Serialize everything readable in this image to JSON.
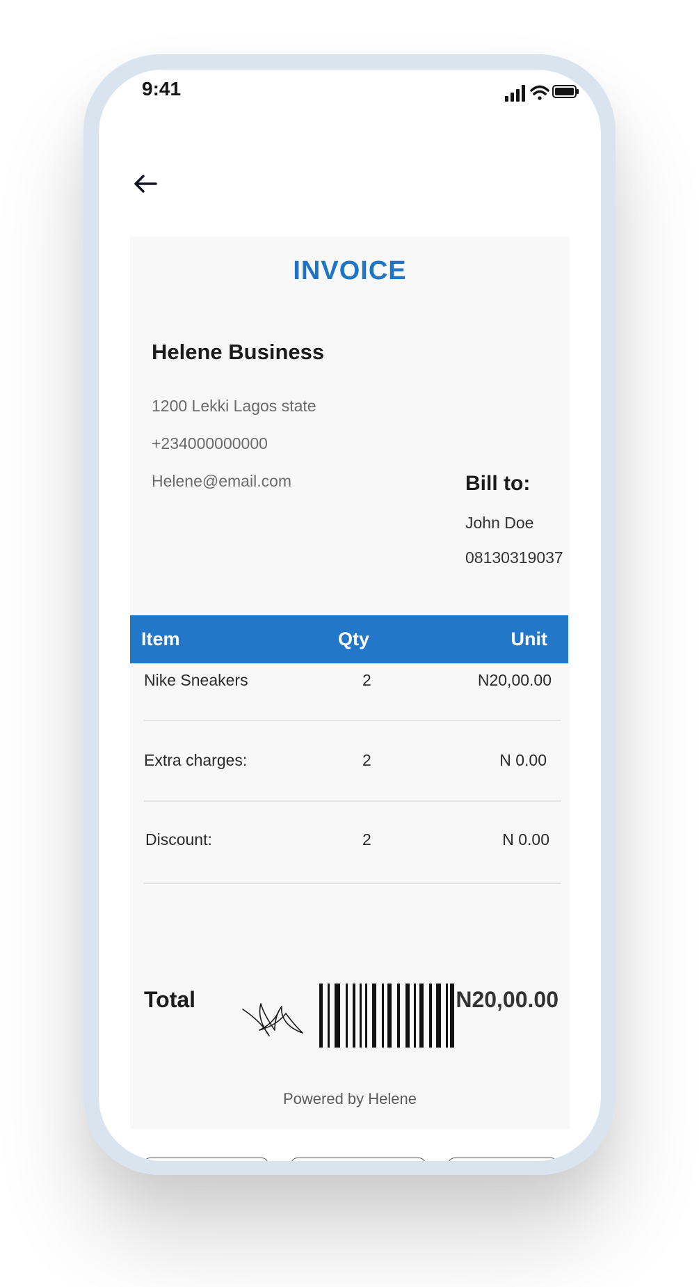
{
  "status_bar": {
    "time": "9:41",
    "icons": [
      "cellular-signal-icon",
      "wifi-icon",
      "battery-icon"
    ]
  },
  "nav": {
    "back_icon": "arrow-left-icon"
  },
  "invoice": {
    "title": "INVOICE",
    "title_color": "#1e75c4",
    "business": {
      "name": "Helene Business",
      "address": "1200 Lekki Lagos state",
      "phone": "+234000000000",
      "email": "Helene@email.com"
    },
    "bill_to": {
      "title": "Bill to:",
      "name": "John Doe",
      "phone": "08130319037"
    },
    "table": {
      "header_color": "#2377c9",
      "columns": [
        "Item",
        "Qty",
        "Unit"
      ],
      "rows": [
        {
          "item": "Nike Sneakers",
          "qty": "2",
          "unit": "N20,00.00"
        },
        {
          "item": "Extra charges:",
          "qty": "2",
          "unit": "N 0.00"
        },
        {
          "item": "Discount:",
          "qty": "2",
          "unit": "N 0.00"
        }
      ]
    },
    "total": {
      "label": "Total",
      "value": "N20,00.00"
    },
    "powered_by": "Powered by Helene"
  }
}
